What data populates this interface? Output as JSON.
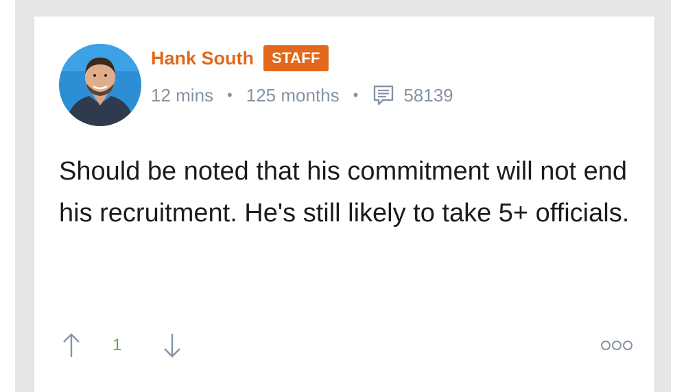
{
  "post": {
    "author": {
      "name": "Hank South",
      "badge": "STAFF",
      "avatar_icon": "user-avatar"
    },
    "meta": {
      "posted_ago": "12 mins",
      "separator": "•",
      "membership": "125 months",
      "comments_icon": "comment-icon",
      "post_count": "58139"
    },
    "body": "Should be noted that his commitment will not end his recruitment. He's still likely to take 5+ officials.",
    "actions": {
      "upvote_icon": "arrow-up-icon",
      "score": "1",
      "downvote_icon": "arrow-down-icon",
      "more_icon": "more-options-icon"
    }
  },
  "colors": {
    "accent": "#e2681b",
    "meta": "#8593a3",
    "score": "#5cb030",
    "text": "#1c1c1c",
    "background": "#e6e6e6"
  }
}
